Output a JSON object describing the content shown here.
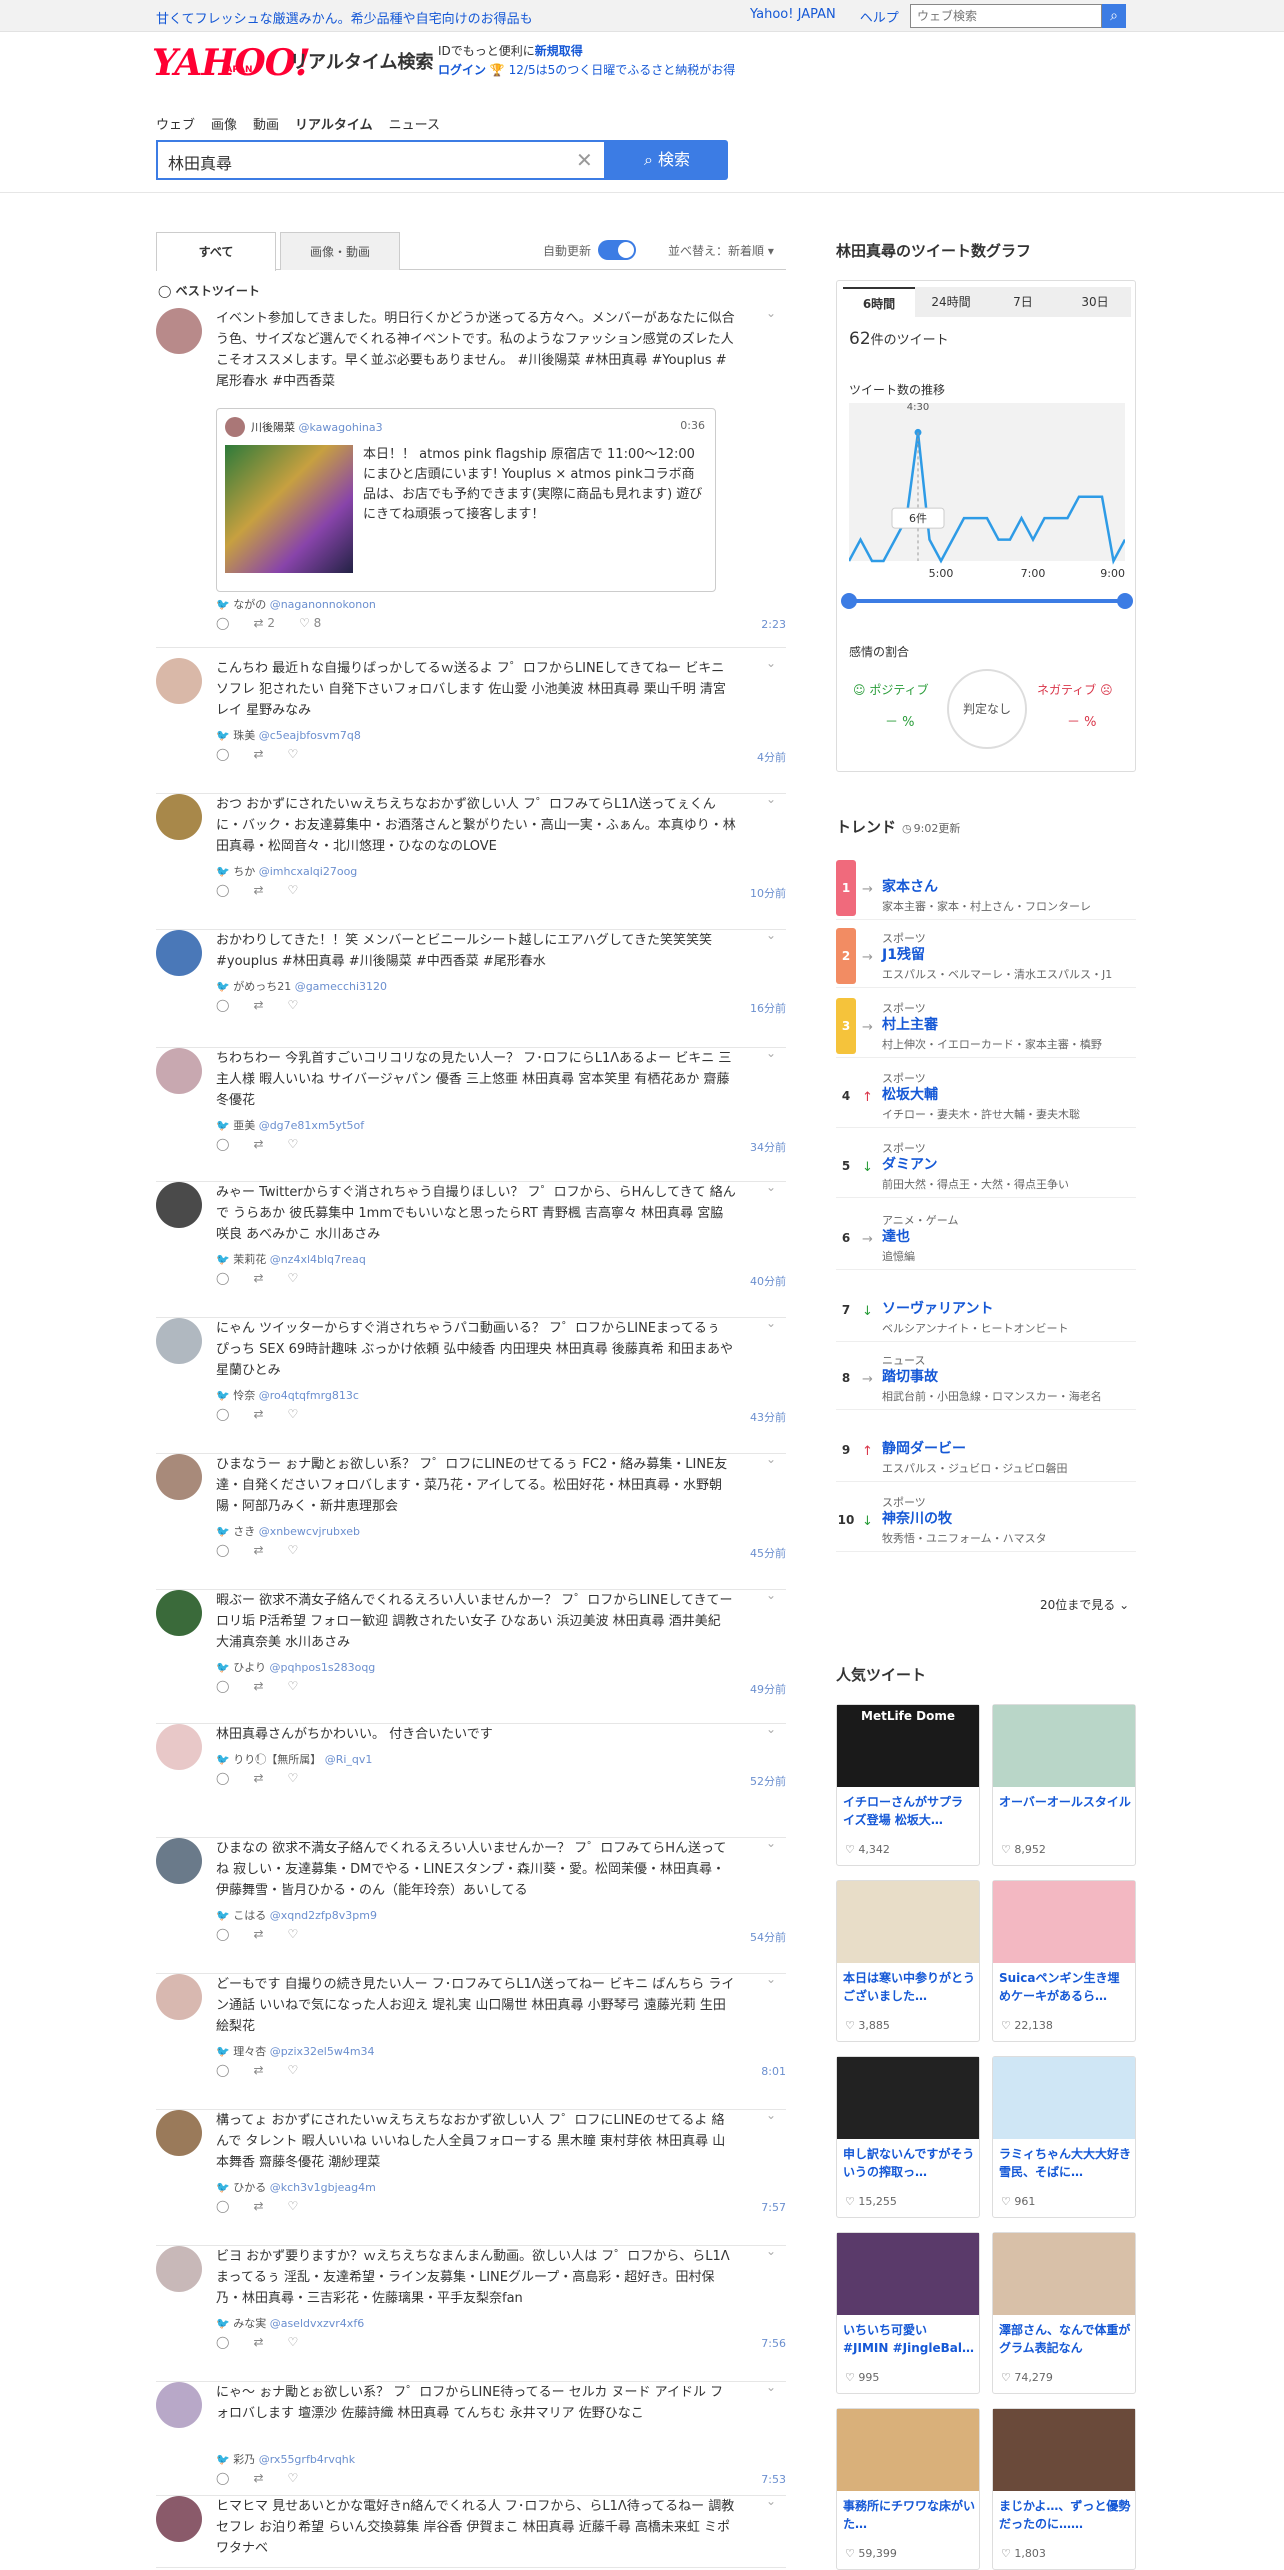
{
  "header": {
    "promo": "甘くてフレッシュな厳選みかん。希少品種や自宅向けのお得品も",
    "links": [
      "Yahoo! JAPAN",
      "ヘルプ"
    ],
    "web_search_placeholder": "ウェブ検索",
    "logo": "YAHOO!",
    "logo_sub": "JAPAN",
    "title": "リアルタイム検索",
    "id_line": "IDでもっと便利に",
    "new_acct": "新規取得",
    "login": "ログイン",
    "promo2": "12/5は5のつく日曜でふるさと納税がお得"
  },
  "nav": {
    "tabs": [
      "ウェブ",
      "画像",
      "動画",
      "リアルタイム",
      "ニュース"
    ],
    "active": "リアルタイム"
  },
  "search": {
    "value": "林田真尋",
    "button": "検索"
  },
  "filters": {
    "tabs": [
      "すべて",
      "画像・動画"
    ],
    "auto_update": "自動更新",
    "sort": "並べ替え：新着順"
  },
  "best_tweet_label": "ベストツイート",
  "tweets": [
    {
      "text": "イベント参加してきました。明日行くかどうか迷ってる方々へ。メンバーがあなたに似合う色、サイズなど選んでくれる神イベントです。私のようなファッション感覚のズレた人こそオススメします。早く並ぶ必要もありません。 #川後陽菜 #林田真尋 #Youplus #尾形春水 #中西香菜",
      "name": "ながの",
      "handle": "@naganonnokonon",
      "time": "2:23",
      "rt": "2",
      "likes": "8"
    },
    {
      "text": "こんちわ 最近ｈな自撮りばっかしてるｗ送るよ フ゜ロフからLINEしてきてねー ビキニ ソフレ 犯されたい 自発下さいフォロバします 佐山愛 小池美波 林田真尋 栗山千明 清宮レイ 星野みなみ",
      "name": "珠美",
      "handle": "@c5eajbfosvm7q8",
      "time": "4分前"
    },
    {
      "text": "おつ おかずにされたいｗえちえちなおかず欲しい人 フ゜ロフみてらL1Λ送ってぇくんに・バック・お友達募集中・お酒落さんと繋がりたい・高山一実・ふぁん。本真ゆり・林田真尋・松岡音々・北川悠理・ひなのなのLOVE",
      "name": "ちか",
      "handle": "@imhcxalqi27oog",
      "time": "10分前"
    },
    {
      "text": "おかわりしてきた！！笑 メンバーとビニールシート越しにエアハグしてきた笑笑笑笑 #youplus #林田真尋 #川後陽菜 #中西香菜 #尾形春水",
      "name": "がめっち21",
      "handle": "@gamecchi3120",
      "time": "16分前"
    },
    {
      "text": "ちわちわー 今乳首すごいコリコリなの見たい人ー？ フ･ロフにらL1Λあるよー ビキニ 三主人様 暇人いいね サイバージャパン 優香 三上悠亜 林田真尋 宮本笑里 有栖花あか 齋藤冬優花",
      "name": "亜美",
      "handle": "@dg7e81xm5yt5of",
      "time": "34分前"
    },
    {
      "text": "みゃー Twitterからすぐ消されちゃう自撮りほしい？ フ゜ロフから、らHんしてきて 絡んで うらあか 彼氏募集中 1mmでもいいなと思ったらRT 青野楓 吉高寧々 林田真尋 宮脇咲良 あべみかこ 水川あさみ",
      "name": "茉莉花",
      "handle": "@nz4xl4blq7reaq",
      "time": "40分前"
    },
    {
      "text": "にゃん ツイッターからすぐ消されちゃうパコ動画いる？ フ゜ロフからLINEまってるぅ ぴっち SEX 69時計趣味 ぶっかけ依頼 弘中綾香 内田理央 林田真尋 後藤真希 和田まあや 星蘭ひとみ",
      "name": "怜奈",
      "handle": "@ro4qtqfmrg813c",
      "time": "43分前"
    },
    {
      "text": "ひまなうー ぉナ勵とぉ欲しい系？ フ゜ロフにLINEのせてるぅ FC2・絡み募集・LINE友達・自発くださいフォロバします・菜乃花・アイしてる。松田好花・林田真尋・水野朝陽・阿部乃みく・新井恵理那会",
      "name": "さき",
      "handle": "@xnbewcvjrubxeb",
      "time": "45分前"
    },
    {
      "text": "暇ぶー 欲求不満女子絡んでくれるえろい人いませんかー？ フ゜ロフからLINEしてきてー ロリ垢 P活希望 フォロー歓迎 調教されたい女子 ひなあい 浜辺美波 林田真尋 酒井美紀 大浦真奈美 水川あさみ",
      "name": "ひより",
      "handle": "@pqhpos1s283oqg",
      "time": "49分前"
    },
    {
      "text": "林田真尋さんがちかわいい。 付き合いたいです",
      "name": "りり！⃝【無所属】",
      "handle": "@Ri_qv1",
      "time": "52分前"
    },
    {
      "text": "ひまなの 欲求不満女子絡んでくれるえろい人いませんかー？ フ゜ロフみてらHん送ってね 寂しい・友達募集・DMでやる・LINEスタンプ・森川葵・愛。松岡茉優・林田真尋・伊藤舞雪・皆月ひかる・のん（能年玲奈）あいしてる",
      "name": "こはる",
      "handle": "@xqnd2zfp8v3pm9",
      "time": "54分前"
    },
    {
      "text": "どーもです 自撮りの続き見たい人ー フ･ロフみてらL1Λ送ってねー ビキニ ばんちら ライン通話 いいねで気になった人お迎え 堤礼実 山口陽世 林田真尋 小野琴弓 遠藤光莉 生田絵梨花",
      "name": "理々杏",
      "handle": "@pzix32el5w4m34",
      "time": "8:01"
    },
    {
      "text": "構ってょ おかずにされたいｗえちえちなおかず欲しい人 フ゜ロフにLINEのせてるよ 絡んで タレント 暇人いいね いいねした人全員フォローする 黒木瞳 東村芽依 林田真尋 山本舞香 齋藤冬優花 潮紗理菜",
      "name": "ひかる",
      "handle": "@kch3v1gbjeag4m",
      "time": "7:57"
    },
    {
      "text": "ビヨ おかず要りますか？ｗえちえちなまんまん動画。欲しい人は フ゜ロフから、らL1Λまってるぅ 淫乱・友達希望・ライン友募集・LINEグループ・高島彩・超好き。田村保乃・林田真尋・三吉彩花・佐藤璃果・平手友梨奈fan",
      "name": "みな実",
      "handle": "@aseldvxzvr4xf6",
      "time": "7:56"
    },
    {
      "text": "にゃ～ ぉナ勵とぉ欲しい系？ フ゜ロフからLINE待ってるー セルカ ヌード アイドル フォロバします 壇漂沙 佐藤詩織 林田真尋 てんちむ 永井マリア 佐野ひなこ",
      "name": "彩乃",
      "handle": "@rx55grfb4rvqhk",
      "time": "7:53"
    },
    {
      "text": "ヒマヒマ 見せあいとかな電好きn絡んでくれる人 フ･ロフから、らL1Λ待ってるねー 調教 セフレ お泊り希望 らいん交換募集 岸谷香 伊賀まこ 林田真尋 近藤千尋 高橋未来虹 ミポワタナベ",
      "name": "",
      "handle": "",
      "time": ""
    }
  ],
  "quote": {
    "name": "川後陽菜",
    "handle": "@kawagohina3",
    "time": "0:36",
    "text": "本日！！ atmos pink flagship 原宿店で 11:00〜12:00にまひと店頭にいます! Youplus × atmos pinkコラボ商品は、お店でも予約できます(実際に商品も見れます) 遊びにきてね頑張って接客します！"
  },
  "graph": {
    "title": "林田真尋のツイート数グラフ",
    "tabs": [
      "6時間",
      "24時間",
      "7日",
      "30日"
    ],
    "count_num": "62",
    "count_suffix": "件のツイート",
    "trend_label": "ツイート数の推移",
    "peak_time": "4:30",
    "tooltip": "6件",
    "x_labels": [
      "5:00",
      "7:00",
      "9:00"
    ],
    "sentiment_title": "感情の割合",
    "positive": "ポジティブ",
    "negative": "ネガティブ",
    "neutral": "判定なし",
    "pos_val": "－ %",
    "neg_val": "－ %"
  },
  "chart_data": {
    "type": "line",
    "x": [
      "3:00",
      "3:15",
      "3:30",
      "3:45",
      "4:00",
      "4:15",
      "4:30",
      "4:45",
      "5:00",
      "5:15",
      "5:30",
      "5:45",
      "6:00",
      "6:15",
      "6:30",
      "6:45",
      "7:00",
      "7:15",
      "7:30",
      "7:45",
      "8:00",
      "8:15",
      "8:30",
      "8:45",
      "9:00"
    ],
    "values": [
      0,
      1,
      0,
      0,
      1,
      2,
      6,
      1,
      0,
      1,
      2,
      2,
      2,
      1,
      1,
      2,
      1,
      2,
      2,
      2,
      3,
      3,
      3,
      0,
      1
    ],
    "annotations": [
      "6件"
    ]
  },
  "trends": {
    "title": "トレンド",
    "updated": "9:02更新",
    "items": [
      {
        "rank": "1",
        "cat": "",
        "word": "家本さん",
        "sub": "家本主審・家本・村上さん・フロンターレ",
        "dir": "→",
        "color": "#f06a7c"
      },
      {
        "rank": "2",
        "cat": "スポーツ",
        "word": "J1残留",
        "sub": "エスパルス・ベルマーレ・清水エスパルス・J1",
        "dir": "→",
        "color": "#f28c63"
      },
      {
        "rank": "3",
        "cat": "スポーツ",
        "word": "村上主審",
        "sub": "村上伸次・イエローカード・家本主審・槙野",
        "dir": "→",
        "color": "#f5c33b"
      },
      {
        "rank": "4",
        "cat": "スポーツ",
        "word": "松坂大輔",
        "sub": "イチロー・妻夫木・許せ大輔・妻夫木聡",
        "dir": "↑",
        "color": ""
      },
      {
        "rank": "5",
        "cat": "スポーツ",
        "word": "ダミアン",
        "sub": "前田大然・得点王・大然・得点王争い",
        "dir": "↓",
        "color": ""
      },
      {
        "rank": "6",
        "cat": "アニメ・ゲーム",
        "word": "達也",
        "sub": "追憶編",
        "dir": "→",
        "color": ""
      },
      {
        "rank": "7",
        "cat": "",
        "word": "ソーヴァリアント",
        "sub": "ベルシアンナイト・ヒートオンビート",
        "dir": "↓",
        "color": ""
      },
      {
        "rank": "8",
        "cat": "ニュース",
        "word": "踏切事故",
        "sub": "相武台前・小田急線・ロマンスカー・海老名",
        "dir": "→",
        "color": ""
      },
      {
        "rank": "9",
        "cat": "",
        "word": "静岡ダービー",
        "sub": "エスパルス・ジュビロ・ジュビロ磐田",
        "dir": "↑",
        "color": ""
      },
      {
        "rank": "10",
        "cat": "スポーツ",
        "word": "神奈川の牧",
        "sub": "牧秀悟・ユニフォーム・ハマスタ",
        "dir": "↓",
        "color": ""
      }
    ],
    "more": "20位まで見る"
  },
  "popular": {
    "title": "人気ツイート",
    "items": [
      {
        "title": "イチローさんがサプライズ登場 松坂大…",
        "likes": "4,342",
        "img": "MetLife Dome",
        "bg": "#1a1a1a"
      },
      {
        "title": "オーバーオールスタイル",
        "likes": "8,952",
        "img": "",
        "bg": "#b9d6c8"
      },
      {
        "title": "本日は寒い中参りがとうございました…",
        "likes": "3,885",
        "img": "",
        "bg": "#e8ddc8"
      },
      {
        "title": "Suicaペンギン生き埋めケーキがあるら…",
        "likes": "22,138",
        "img": "",
        "bg": "#f3b8c2"
      },
      {
        "title": "申し訳ないんですがそういうの搾取っ…",
        "likes": "15,255",
        "img": "",
        "bg": "#222"
      },
      {
        "title": "ラミィちゃん大大大好き 雪民、そばに…",
        "likes": "961",
        "img": "",
        "bg": "#cfe6f5"
      },
      {
        "title": "いちいち可愛い #JIMIN #JingleBal…",
        "likes": "995",
        "img": "",
        "bg": "#5a3a6a"
      },
      {
        "title": "澤部さん、なんで体重がグラム表記なん",
        "likes": "74,279",
        "img": "",
        "bg": "#d8c0a8"
      },
      {
        "title": "事務所にチワワな床がいた…",
        "likes": "59,399",
        "img": "",
        "bg": "#d9b07a"
      },
      {
        "title": "まじかよ…、ずっと優勢だったのに……",
        "likes": "1,803",
        "img": "",
        "bg": "#6a4a3a"
      }
    ]
  }
}
